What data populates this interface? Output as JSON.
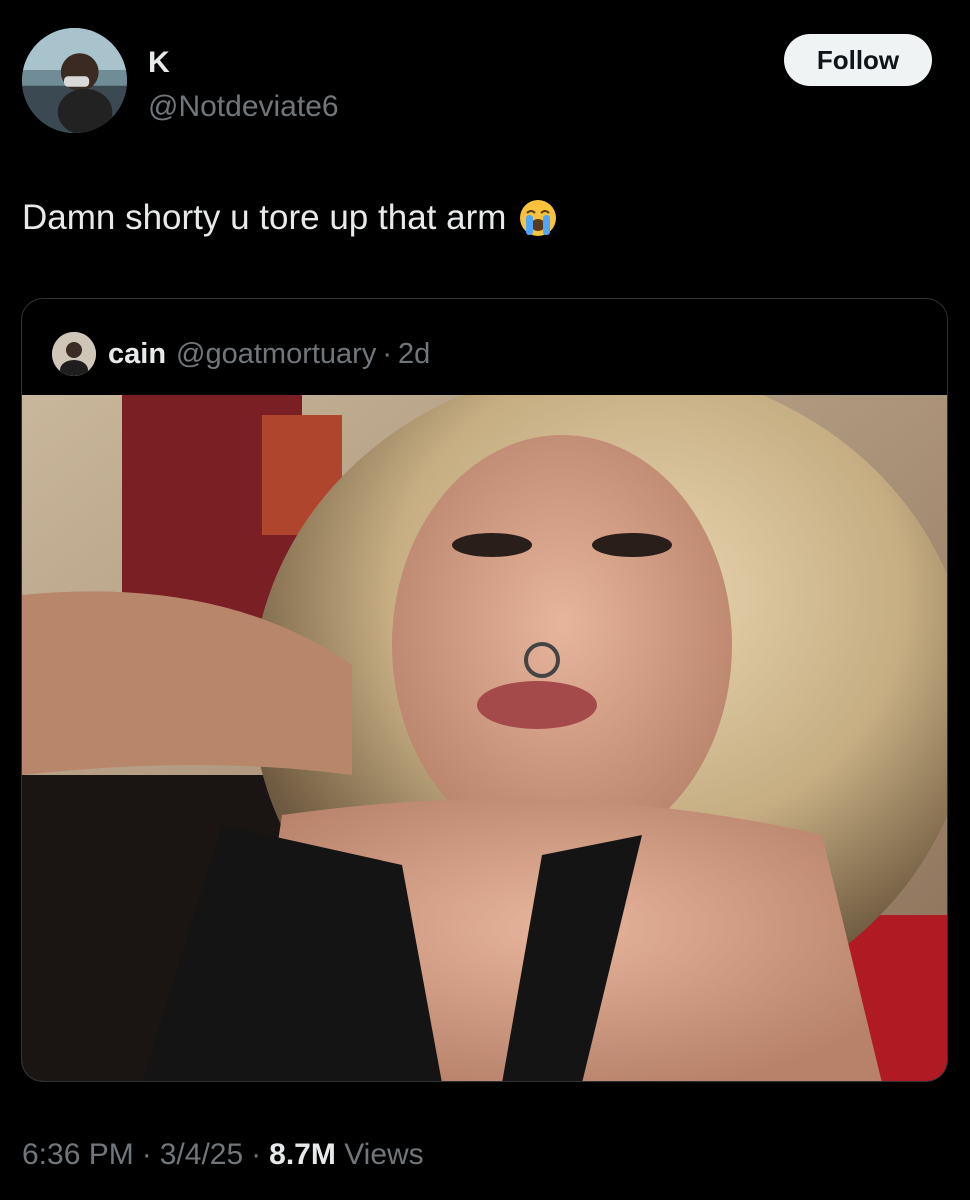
{
  "author": {
    "display_name": "K",
    "handle": "@Notdeviate6",
    "avatar_icon": "profile-photo-avatar"
  },
  "follow_button": {
    "label": "Follow"
  },
  "tweet": {
    "text": "Damn shorty u tore up that arm",
    "emoji_icon": "loudly-crying-face-icon"
  },
  "quoted_tweet": {
    "display_name": "cain",
    "handle": "@goatmortuary",
    "separator": "·",
    "time": "2d",
    "media_icon": "selfie-photo"
  },
  "meta": {
    "time": "6:36 PM",
    "separator": "·",
    "date": "3/4/25",
    "views_count": "8.7M",
    "views_label": "Views"
  },
  "colors": {
    "background": "#000000",
    "primary_text": "#e7e9ea",
    "secondary_text": "#71767b",
    "border": "#2f3336",
    "follow_bg": "#eff3f4"
  }
}
